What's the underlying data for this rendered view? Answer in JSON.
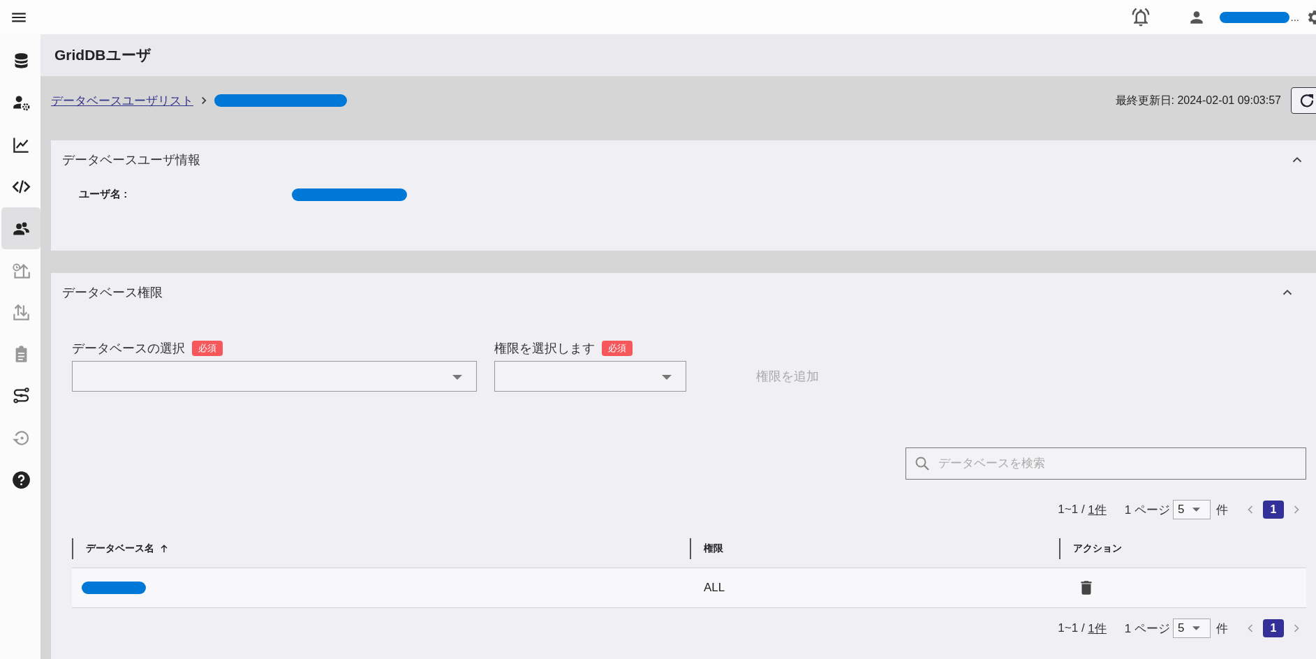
{
  "top_bar": {
    "user": {
      "kind": "redacted",
      "tail": "..."
    }
  },
  "sidebar": {
    "items": [
      {
        "selected": false,
        "disabled": false
      },
      {
        "selected": false,
        "disabled": false
      },
      {
        "selected": false,
        "disabled": false
      },
      {
        "selected": false,
        "disabled": false
      },
      {
        "selected": true,
        "disabled": false
      },
      {
        "selected": false,
        "disabled": true
      },
      {
        "selected": false,
        "disabled": true
      },
      {
        "selected": false,
        "disabled": true
      },
      {
        "selected": false,
        "disabled": false
      },
      {
        "selected": false,
        "disabled": true
      },
      {
        "selected": false,
        "disabled": false
      }
    ]
  },
  "page_title": "GridDBユーザ",
  "breadcrumb": {
    "link": "データベースユーザリスト",
    "current": {
      "kind": "redacted"
    }
  },
  "last_updated": "最終更新日: 2024-02-01 09:03:57",
  "user_info": {
    "title": "データベースユーザ情報",
    "expanded": true,
    "label": "ユーザ名 :",
    "value": {
      "kind": "redacted"
    }
  },
  "privileges": {
    "title": "データベース権限",
    "expanded": true,
    "database_select": {
      "label": "データベースの選択",
      "required": "必須"
    },
    "privilege_select": {
      "label": "権限を選択します",
      "required": "必須"
    },
    "add_button": {
      "label": "権限を追加",
      "disabled": true
    },
    "search": {
      "placeholder": "データベースを検索"
    },
    "paginations": [
      {
        "range": "1~1 / ",
        "total": "1件",
        "per_page_label": "1 ページ",
        "per_page": "5",
        "unit": "件",
        "pages": [
          {
            "label": "1",
            "selected": true
          }
        ]
      },
      {
        "range": "1~1 / ",
        "total": "1件",
        "per_page_label": "1 ページ",
        "per_page": "5",
        "unit": "件",
        "pages": [
          {
            "label": "1",
            "selected": true
          }
        ]
      }
    ],
    "table": {
      "columns": [
        {
          "label": "データベース名",
          "sorted": true
        },
        {
          "label": "権限",
          "sorted": false
        },
        {
          "label": "アクション",
          "sorted": false
        }
      ],
      "rows": [
        {
          "name": {
            "kind": "redacted"
          },
          "privilege": "ALL"
        }
      ]
    }
  }
}
